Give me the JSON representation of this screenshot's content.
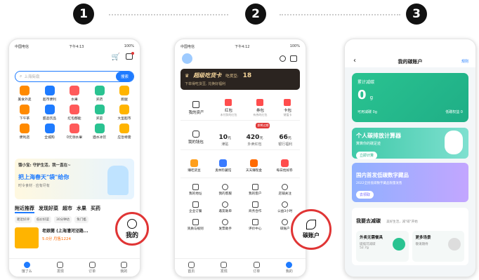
{
  "steps": [
    "1",
    "2",
    "3"
  ],
  "p1": {
    "status": {
      "carrier": "中国电信",
      "time": "下午4:13",
      "battery": "100%"
    },
    "search": {
      "placeholder": "上海街扇",
      "button": "搜索"
    },
    "cats1": [
      "美食外卖",
      "超市便利",
      "水果",
      "买药",
      "跑腿"
    ],
    "cats2": [
      "下午茶",
      "甜品饮品",
      "红包都能",
      "买菜",
      "大型超市"
    ],
    "cats3": [
      "便利店",
      "全城购",
      "0元领水果",
      "酒水冰饮",
      "应急特需"
    ],
    "banner": {
      "brand": "饿小宝: 守护生活，我一直在~",
      "title": "把上海春天\"袋\"给你",
      "sub": "时令食材 · 应有尽有"
    },
    "tabs": [
      "附近推荐",
      "发现好菜",
      "超市",
      "水果",
      "买药"
    ],
    "filters": [
      "距近好评",
      "低价好菜",
      "30分钟达",
      "免门槛"
    ],
    "shop": {
      "name": "老娘舅 (上海漕河泾路...",
      "meta": "5.0分  月售1224",
      "time": "35分钟"
    },
    "tabbar": [
      "饿了么",
      "发现",
      "订单",
      "我的"
    ],
    "circle": "我的"
  },
  "p2": {
    "status": {
      "carrier": "中国电信",
      "time": "下午4:12",
      "battery": "100%"
    },
    "vip": {
      "title": "超级吃货卡",
      "label": "吃货豆:",
      "value": "18",
      "sub": "下单得吃货豆, 兑换好福利"
    },
    "assets": [
      "我的资产",
      "红包",
      "券包",
      "卡包"
    ],
    "assets_sub": [
      "",
      "未付款的红包",
      "有券的红包",
      "储值卡"
    ],
    "wallet": {
      "label": "我的钱包",
      "items": [
        {
          "v": "10",
          "u": "元",
          "l": "津贴"
        },
        {
          "v": "420",
          "u": "元",
          "l": "外卖红包",
          "badge": "即将过期"
        },
        {
          "v": "66",
          "u": "元",
          "l": "银行福利"
        }
      ]
    },
    "services1": [
      "赚吃货豆",
      "奥林珍藏馆",
      "天天赚现金",
      "每日抢好券"
    ],
    "grid": [
      "我的地址",
      "我的客服",
      "我的客户",
      "店铺关注",
      "企业订餐",
      "邀友助单",
      "商务合作",
      "公益3小时",
      "资质与规则",
      "发票助手",
      "评价中心",
      "碳账户"
    ],
    "tabbar": [
      "首页",
      "发现",
      "订单",
      "我的"
    ],
    "circle": "碳账户"
  },
  "p3": {
    "title": "我的碳账户",
    "rule": "规则",
    "card": {
      "label": "累计减碳",
      "value": "0",
      "unit": "g",
      "avail": "可用减碳 0g",
      "low": "低碳权益 0"
    },
    "promo1": {
      "title": "个人碳排放计算器",
      "sub": "算算你的碳足迹",
      "btn": "立即计算"
    },
    "promo2": {
      "title": "国内首发低碳数字藏品",
      "sub": "2022全民低碳数字藏品限量发售",
      "btn": "去领取"
    },
    "section": "我要去减碳",
    "section_sub": "美好生活，减\"碳\"开始",
    "tiles": [
      {
        "t": "外卖无需餐具",
        "s": "碳排可减碳 52.7g"
      },
      {
        "t": "更多场景",
        "s": "敬请期待"
      }
    ]
  },
  "colors": {
    "blue": "#1e7bff",
    "green": "#2ac391",
    "red": "#e03535",
    "orange": "#ff6a00"
  }
}
